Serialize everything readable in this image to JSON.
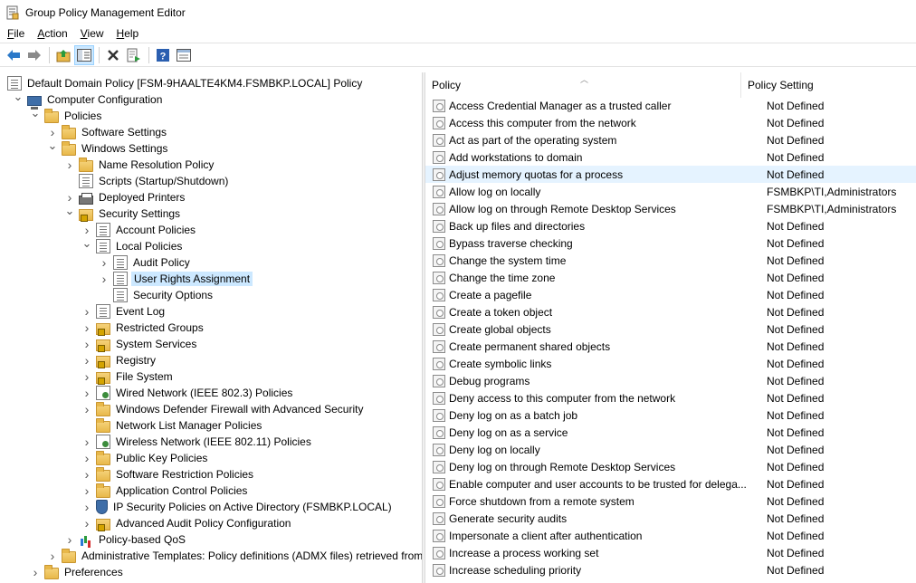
{
  "window": {
    "title": "Group Policy Management Editor"
  },
  "menu": [
    "File",
    "Action",
    "View",
    "Help"
  ],
  "toolbar": [
    "back-arrow-icon",
    "forward-arrow-icon",
    "up-folder-icon",
    "show-hide-tree-icon",
    "delete-icon",
    "export-list-icon",
    "help-icon",
    "properties-icon"
  ],
  "tree": [
    {
      "label": "Default Domain Policy [FSM-9HAALTE4KM4.FSMBKP.LOCAL] Policy",
      "level": 0,
      "chev": "",
      "icon": "doc"
    },
    {
      "label": "Computer Configuration",
      "level": 1,
      "chev": "open",
      "icon": "computer"
    },
    {
      "label": "Policies",
      "level": 2,
      "chev": "open",
      "icon": "folder"
    },
    {
      "label": "Software Settings",
      "level": 3,
      "chev": "closed",
      "icon": "folder"
    },
    {
      "label": "Windows Settings",
      "level": 3,
      "chev": "open",
      "icon": "folder"
    },
    {
      "label": "Name Resolution Policy",
      "level": 4,
      "chev": "closed",
      "icon": "folder"
    },
    {
      "label": "Scripts (Startup/Shutdown)",
      "level": 4,
      "chev": "",
      "icon": "doc"
    },
    {
      "label": "Deployed Printers",
      "level": 4,
      "chev": "closed",
      "icon": "printer"
    },
    {
      "label": "Security Settings",
      "level": 4,
      "chev": "open",
      "icon": "lockfolder"
    },
    {
      "label": "Account Policies",
      "level": 5,
      "chev": "closed",
      "icon": "doc"
    },
    {
      "label": "Local Policies",
      "level": 5,
      "chev": "open",
      "icon": "doc"
    },
    {
      "label": "Audit Policy",
      "level": 6,
      "chev": "closed",
      "icon": "doc"
    },
    {
      "label": "User Rights Assignment",
      "level": 6,
      "chev": "closed",
      "icon": "doc",
      "selected": true
    },
    {
      "label": "Security Options",
      "level": 6,
      "chev": "",
      "icon": "doc"
    },
    {
      "label": "Event Log",
      "level": 5,
      "chev": "closed",
      "icon": "doc"
    },
    {
      "label": "Restricted Groups",
      "level": 5,
      "chev": "closed",
      "icon": "lockfolder"
    },
    {
      "label": "System Services",
      "level": 5,
      "chev": "closed",
      "icon": "lockfolder"
    },
    {
      "label": "Registry",
      "level": 5,
      "chev": "closed",
      "icon": "lockfolder"
    },
    {
      "label": "File System",
      "level": 5,
      "chev": "closed",
      "icon": "lockfolder"
    },
    {
      "label": "Wired Network (IEEE 802.3) Policies",
      "level": 5,
      "chev": "closed",
      "icon": "netdoc"
    },
    {
      "label": "Windows Defender Firewall with Advanced Security",
      "level": 5,
      "chev": "closed",
      "icon": "folder"
    },
    {
      "label": "Network List Manager Policies",
      "level": 5,
      "chev": "",
      "icon": "folder"
    },
    {
      "label": "Wireless Network (IEEE 802.11) Policies",
      "level": 5,
      "chev": "closed",
      "icon": "netdoc"
    },
    {
      "label": "Public Key Policies",
      "level": 5,
      "chev": "closed",
      "icon": "folder"
    },
    {
      "label": "Software Restriction Policies",
      "level": 5,
      "chev": "closed",
      "icon": "folder"
    },
    {
      "label": "Application Control Policies",
      "level": 5,
      "chev": "closed",
      "icon": "folder"
    },
    {
      "label": "IP Security Policies on Active Directory (FSMBKP.LOCAL)",
      "level": 5,
      "chev": "closed",
      "icon": "shield"
    },
    {
      "label": "Advanced Audit Policy Configuration",
      "level": 5,
      "chev": "closed",
      "icon": "lockfolder"
    },
    {
      "label": "Policy-based QoS",
      "level": 4,
      "chev": "closed",
      "icon": "chart"
    },
    {
      "label": "Administrative Templates: Policy definitions (ADMX files) retrieved from",
      "level": 3,
      "chev": "closed",
      "icon": "folder"
    },
    {
      "label": "Preferences",
      "level": 2,
      "chev": "closed",
      "icon": "folder"
    }
  ],
  "list": {
    "col_policy": "Policy",
    "col_setting": "Policy Setting",
    "rows": [
      {
        "policy": "Access Credential Manager as a trusted caller",
        "setting": "Not Defined"
      },
      {
        "policy": "Access this computer from the network",
        "setting": "Not Defined"
      },
      {
        "policy": "Act as part of the operating system",
        "setting": "Not Defined"
      },
      {
        "policy": "Add workstations to domain",
        "setting": "Not Defined"
      },
      {
        "policy": "Adjust memory quotas for a process",
        "setting": "Not Defined",
        "hover": true
      },
      {
        "policy": "Allow log on locally",
        "setting": "FSMBKP\\TI,Administrators"
      },
      {
        "policy": "Allow log on through Remote Desktop Services",
        "setting": "FSMBKP\\TI,Administrators"
      },
      {
        "policy": "Back up files and directories",
        "setting": "Not Defined"
      },
      {
        "policy": "Bypass traverse checking",
        "setting": "Not Defined"
      },
      {
        "policy": "Change the system time",
        "setting": "Not Defined"
      },
      {
        "policy": "Change the time zone",
        "setting": "Not Defined"
      },
      {
        "policy": "Create a pagefile",
        "setting": "Not Defined"
      },
      {
        "policy": "Create a token object",
        "setting": "Not Defined"
      },
      {
        "policy": "Create global objects",
        "setting": "Not Defined"
      },
      {
        "policy": "Create permanent shared objects",
        "setting": "Not Defined"
      },
      {
        "policy": "Create symbolic links",
        "setting": "Not Defined"
      },
      {
        "policy": "Debug programs",
        "setting": "Not Defined"
      },
      {
        "policy": "Deny access to this computer from the network",
        "setting": "Not Defined"
      },
      {
        "policy": "Deny log on as a batch job",
        "setting": "Not Defined"
      },
      {
        "policy": "Deny log on as a service",
        "setting": "Not Defined"
      },
      {
        "policy": "Deny log on locally",
        "setting": "Not Defined"
      },
      {
        "policy": "Deny log on through Remote Desktop Services",
        "setting": "Not Defined"
      },
      {
        "policy": "Enable computer and user accounts to be trusted for delega...",
        "setting": "Not Defined"
      },
      {
        "policy": "Force shutdown from a remote system",
        "setting": "Not Defined"
      },
      {
        "policy": "Generate security audits",
        "setting": "Not Defined"
      },
      {
        "policy": "Impersonate a client after authentication",
        "setting": "Not Defined"
      },
      {
        "policy": "Increase a process working set",
        "setting": "Not Defined"
      },
      {
        "policy": "Increase scheduling priority",
        "setting": "Not Defined"
      }
    ]
  }
}
